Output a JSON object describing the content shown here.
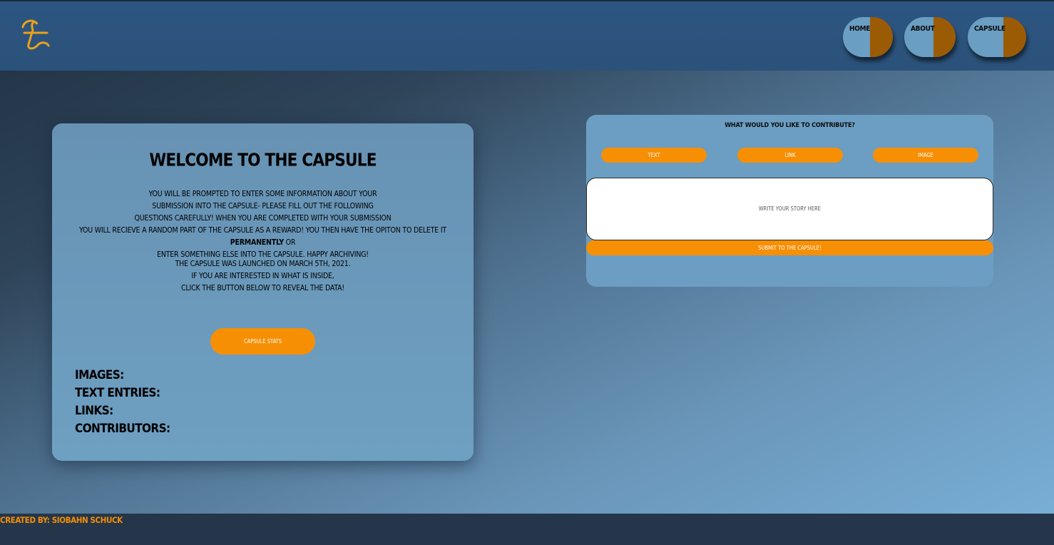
{
  "header": {
    "logo_letter": "t",
    "nav": [
      {
        "label": "HOME"
      },
      {
        "label": "ABOUT"
      },
      {
        "label": "CAPSULE"
      }
    ]
  },
  "welcome": {
    "title": "Welcome to the Capsule",
    "intro_lines": [
      "You will be prompted to enter some information about your",
      "submission into the capsule- please fill out the following",
      "questions carefully! When you are completed with your submission",
      "You will recieve a random part of the capsule as a reward! You then have the opiton to delete it",
      "permanently",
      "or",
      "enter something else into the capsule. Happy Archiving!"
    ],
    "launch_lines": [
      "The capsule was launched on March 5th, 2021.",
      "If you are interested in what is inside,",
      "click the button below to reveal the data!"
    ],
    "stats_button": "Capsule Stats",
    "stats": [
      {
        "label": "Images:"
      },
      {
        "label": "Text Entries:"
      },
      {
        "label": "Links:"
      },
      {
        "label": "Contributors:"
      }
    ]
  },
  "contribute": {
    "title": "What would you like to contribute?",
    "types": [
      {
        "label": "Text"
      },
      {
        "label": "Link"
      },
      {
        "label": "Image"
      }
    ],
    "story_placeholder": "Write your story here",
    "submit_label": "Submit to the Capsule!"
  },
  "footer": {
    "credit": "Created By: Siobahn Schuck"
  },
  "colors": {
    "accent": "#f78f04",
    "nav_left": "#6a9ec3",
    "nav_right": "#9b5b05",
    "header_bg": "#2d5582",
    "card_bg": "#6b9ec2"
  }
}
